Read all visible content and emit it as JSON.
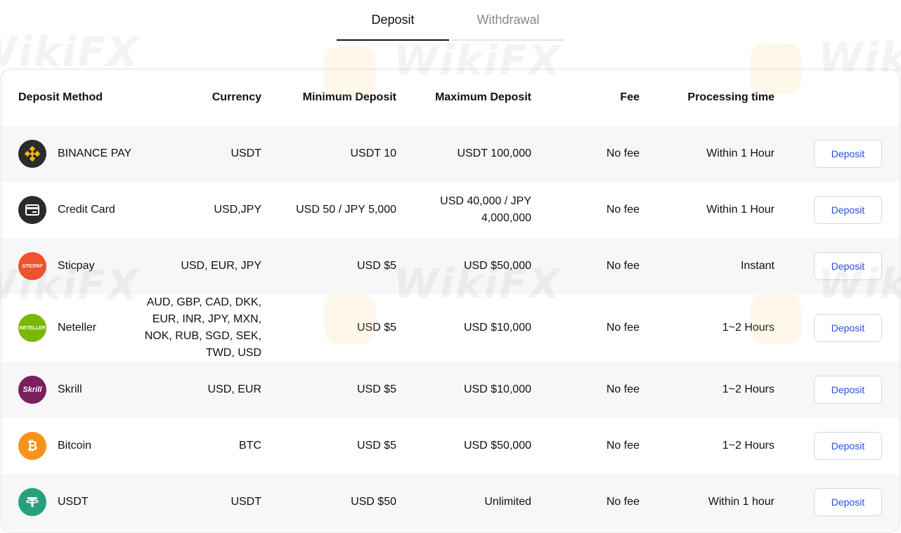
{
  "tabs": {
    "deposit": "Deposit",
    "withdrawal": "Withdrawal"
  },
  "headers": {
    "method": "Deposit Method",
    "currency": "Currency",
    "min": "Minimum Deposit",
    "max": "Maximum Deposit",
    "fee": "Fee",
    "time": "Processing time"
  },
  "rows": [
    {
      "name": "BINANCE PAY",
      "currency": "USDT",
      "min": "USDT 10",
      "max": "USDT 100,000",
      "fee": "No fee",
      "time": "Within 1 Hour",
      "button": "Deposit",
      "icon": "binance-icon",
      "icon_color": "#2b2b2b"
    },
    {
      "name": "Credit Card",
      "currency": "USD,JPY",
      "min": "USD 50 / JPY 5,000",
      "max": "USD 40,000 / JPY 4,000,000",
      "fee": "No fee",
      "time": "Within 1 Hour",
      "button": "Deposit",
      "icon": "credit-card-icon",
      "icon_color": "#2b2b2b"
    },
    {
      "name": "Sticpay",
      "currency": "USD, EUR, JPY",
      "min": "USD $5",
      "max": "USD $50,000",
      "fee": "No fee",
      "time": "Instant",
      "button": "Deposit",
      "icon": "sticpay-icon",
      "icon_color": "#f0532b",
      "icon_text": "STICPAY"
    },
    {
      "name": "Neteller",
      "currency": "AUD, GBP, CAD, DKK, EUR, INR, JPY, MXN, NOK, RUB, SGD, SEK, TWD, USD",
      "min": "USD $5",
      "max": "USD $10,000",
      "fee": "No fee",
      "time": "1~2 Hours",
      "button": "Deposit",
      "icon": "neteller-icon",
      "icon_color": "#7ab800",
      "icon_text": "NETELLER"
    },
    {
      "name": "Skrill",
      "currency": "USD, EUR",
      "min": "USD $5",
      "max": "USD $10,000",
      "fee": "No fee",
      "time": "1~2 Hours",
      "button": "Deposit",
      "icon": "skrill-icon",
      "icon_color": "#7a1f5c",
      "icon_text": "Skrill"
    },
    {
      "name": "Bitcoin",
      "currency": "BTC",
      "min": "USD $5",
      "max": "USD $50,000",
      "fee": "No fee",
      "time": "1~2 Hours",
      "button": "Deposit",
      "icon": "bitcoin-icon",
      "icon_color": "#f7931a"
    },
    {
      "name": "USDT",
      "currency": "USDT",
      "min": "USD $50",
      "max": "Unlimited",
      "fee": "No fee",
      "time": "Within 1 hour",
      "button": "Deposit",
      "icon": "tether-icon",
      "icon_color": "#26a17b"
    }
  ],
  "watermark": "WikiFX"
}
